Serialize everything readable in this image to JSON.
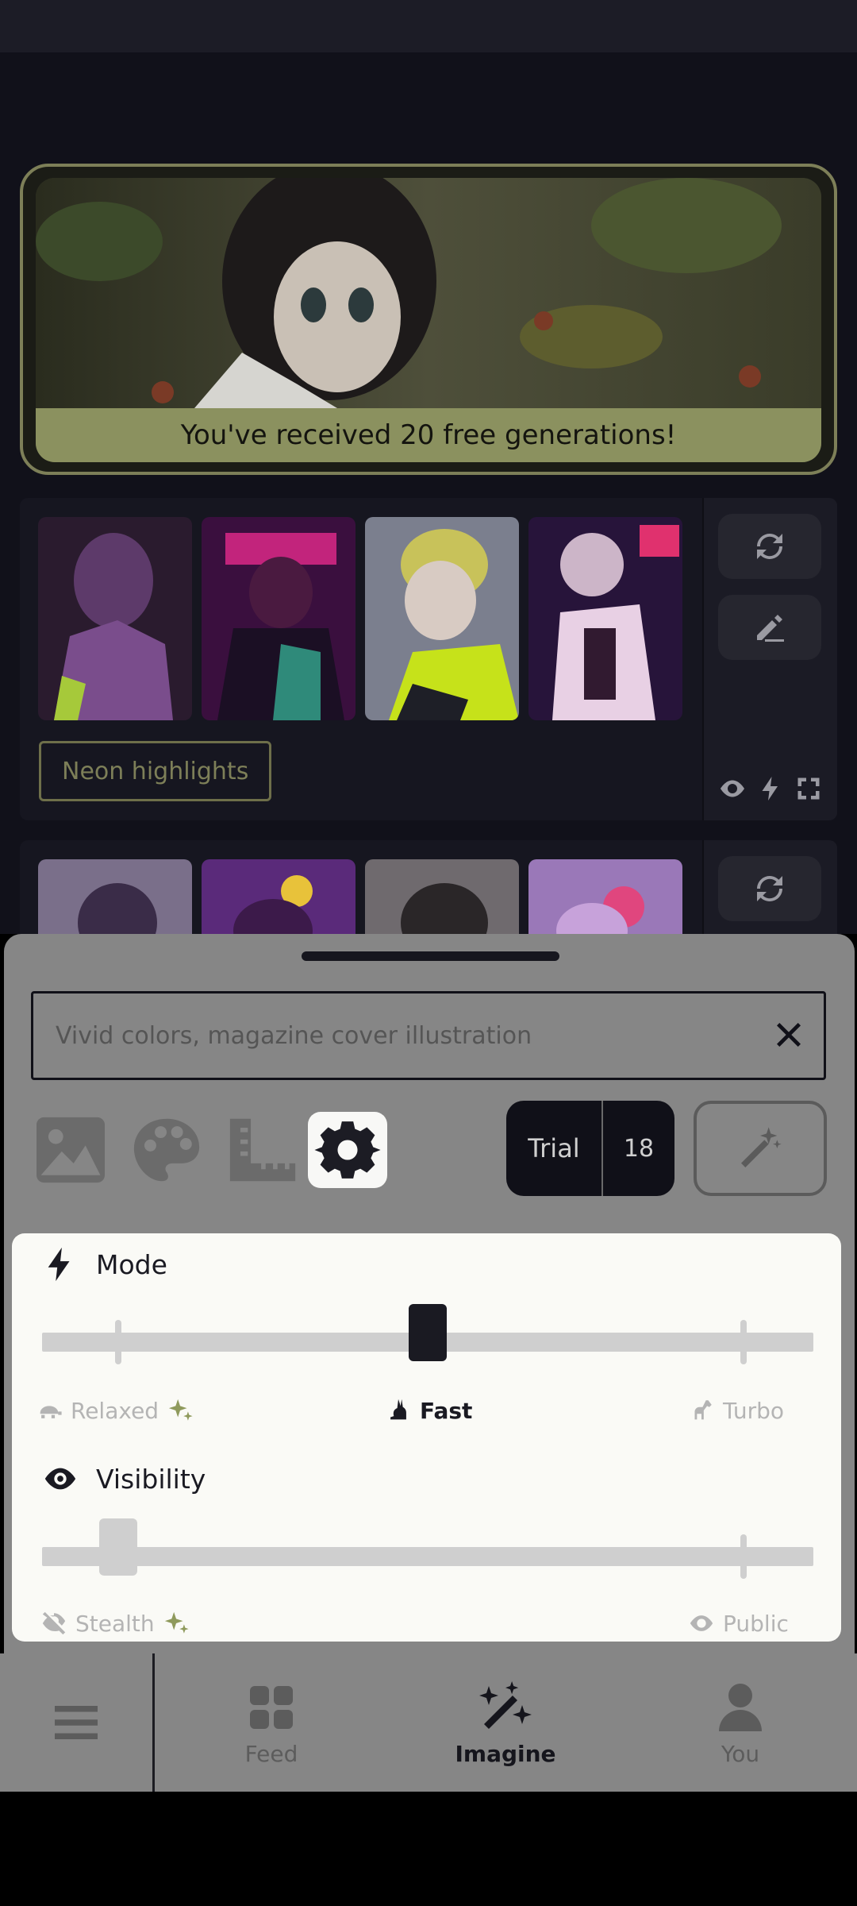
{
  "promo": {
    "caption": "You've received 20 free generations!"
  },
  "generations": [
    {
      "tag": "Neon highlights"
    }
  ],
  "prompt": {
    "placeholder": "Vivid colors, magazine cover illustration"
  },
  "plan": {
    "label": "Trial",
    "count": "18"
  },
  "mode": {
    "title": "Mode",
    "options": [
      "Relaxed",
      "Fast",
      "Turbo"
    ],
    "selected": "Fast",
    "level_fraction": 0.5
  },
  "visibility": {
    "title": "Visibility",
    "options": [
      "Stealth",
      "Public"
    ],
    "selected": "Stealth"
  },
  "nav": {
    "feed": "Feed",
    "imagine": "Imagine",
    "you": "You"
  },
  "colors": {
    "promo_border": "#7d7f58",
    "sparkle": "#8f9a5c",
    "active_tool_bg": "#f8f8f6"
  }
}
